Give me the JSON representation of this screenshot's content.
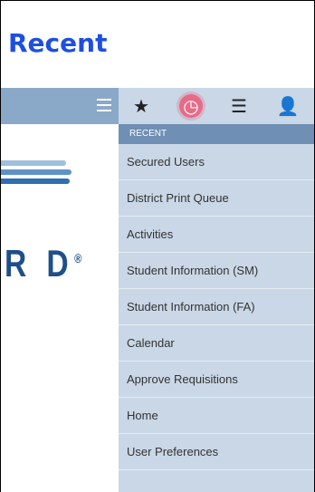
{
  "page": {
    "title": "Recent"
  },
  "left_panel": {
    "menu_icon": "hamburger-menu-icon",
    "logo_text": "R D",
    "logo_reg": "®"
  },
  "tabs": [
    {
      "name": "favorites",
      "icon": "star-icon",
      "glyph": "★",
      "active": false
    },
    {
      "name": "recent",
      "icon": "clock-icon",
      "glyph": "◷",
      "active": true
    },
    {
      "name": "list",
      "icon": "list-icon",
      "glyph": "☰",
      "active": false
    },
    {
      "name": "user",
      "icon": "user-icon",
      "glyph": "👤",
      "active": false
    }
  ],
  "recent": {
    "header": "RECENT",
    "items": [
      "Secured Users",
      "District Print Queue",
      "Activities",
      "Student Information (SM)",
      "Student Information (FA)",
      "Calendar",
      "Approve Requisitions",
      "Home",
      "User Preferences"
    ]
  },
  "colors": {
    "title": "#1e4fe0",
    "panel_bg": "#c9d7e6",
    "header_bg": "#6f8fb4",
    "active_tab": "#e76b87",
    "left_bar": "#8aa8c8"
  }
}
